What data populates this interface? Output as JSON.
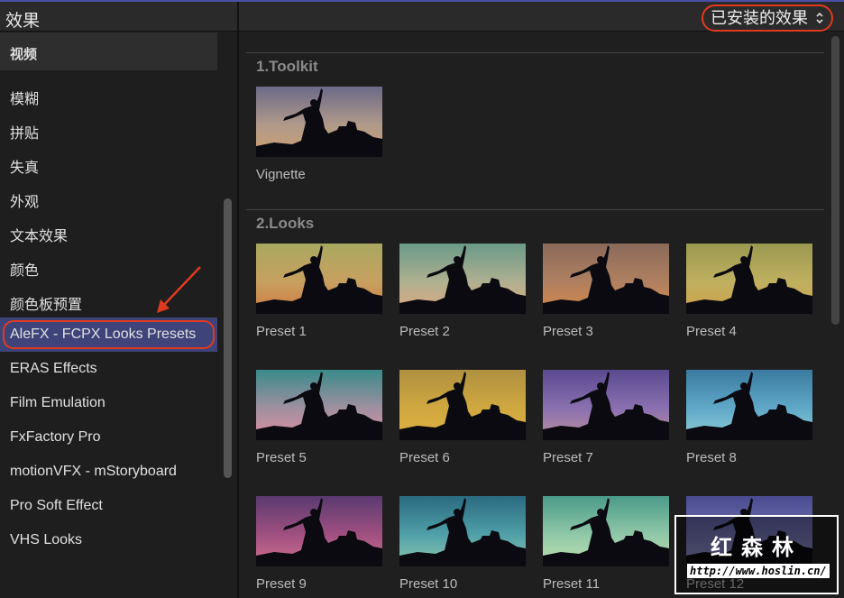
{
  "header": {
    "title": "效果",
    "filter_label": "已安装的效果",
    "filter_icon": "updown-chevron-icon"
  },
  "sidebar": {
    "category": "视频",
    "items": [
      "模糊",
      "拼贴",
      "失真",
      "外观",
      "文本效果",
      "颜色",
      "颜色板预置",
      "AleFX - FCPX Looks Presets",
      "ERAS Effects",
      "Film Emulation",
      "FxFactory Pro",
      "motionVFX - mStoryboard",
      "Pro Soft Effect",
      "VHS Looks"
    ],
    "selected_index": 7
  },
  "sections": [
    {
      "title": "1.Toolkit",
      "items": [
        {
          "label": "Vignette",
          "colors": [
            "#6c6a88",
            "#b09a8a",
            "#d0a070"
          ]
        }
      ]
    },
    {
      "title": "2.Looks",
      "items": [
        {
          "label": "Preset 1",
          "colors": [
            "#a8a860",
            "#c8a060",
            "#d07840"
          ]
        },
        {
          "label": "Preset 2",
          "colors": [
            "#6a9a88",
            "#b0b090",
            "#e0a880"
          ]
        },
        {
          "label": "Preset 3",
          "colors": [
            "#8a6a5a",
            "#b08060",
            "#d88848"
          ]
        },
        {
          "label": "Preset 4",
          "colors": [
            "#9a9850",
            "#c0b060",
            "#d0a048"
          ]
        },
        {
          "label": "Preset 5",
          "colors": [
            "#3a8a8a",
            "#a090a0",
            "#e090a0"
          ]
        },
        {
          "label": "Preset 6",
          "colors": [
            "#b09040",
            "#d0a840",
            "#e0b040"
          ]
        },
        {
          "label": "Preset 7",
          "colors": [
            "#5a4a90",
            "#8a70b0",
            "#c090a0"
          ]
        },
        {
          "label": "Preset 8",
          "colors": [
            "#3a7aa0",
            "#60a8c8",
            "#90d0d8"
          ]
        },
        {
          "label": "Preset 9",
          "colors": [
            "#5a3a70",
            "#a05080",
            "#d07090"
          ]
        },
        {
          "label": "Preset 10",
          "colors": [
            "#2a6a80",
            "#50a0a8",
            "#90c8b0"
          ]
        },
        {
          "label": "Preset 11",
          "colors": [
            "#4a9a88",
            "#90c8a8",
            "#c0e0b0"
          ]
        },
        {
          "label": "Preset 12",
          "colors": [
            "#4a4a90",
            "#7070b0",
            "#9090c0"
          ]
        }
      ]
    }
  ],
  "watermark": {
    "title": "红森林",
    "url": "http://www.hoslin.cn/"
  },
  "colors": {
    "accent_outline": "#e03a1e",
    "selection": "#3e4479"
  }
}
